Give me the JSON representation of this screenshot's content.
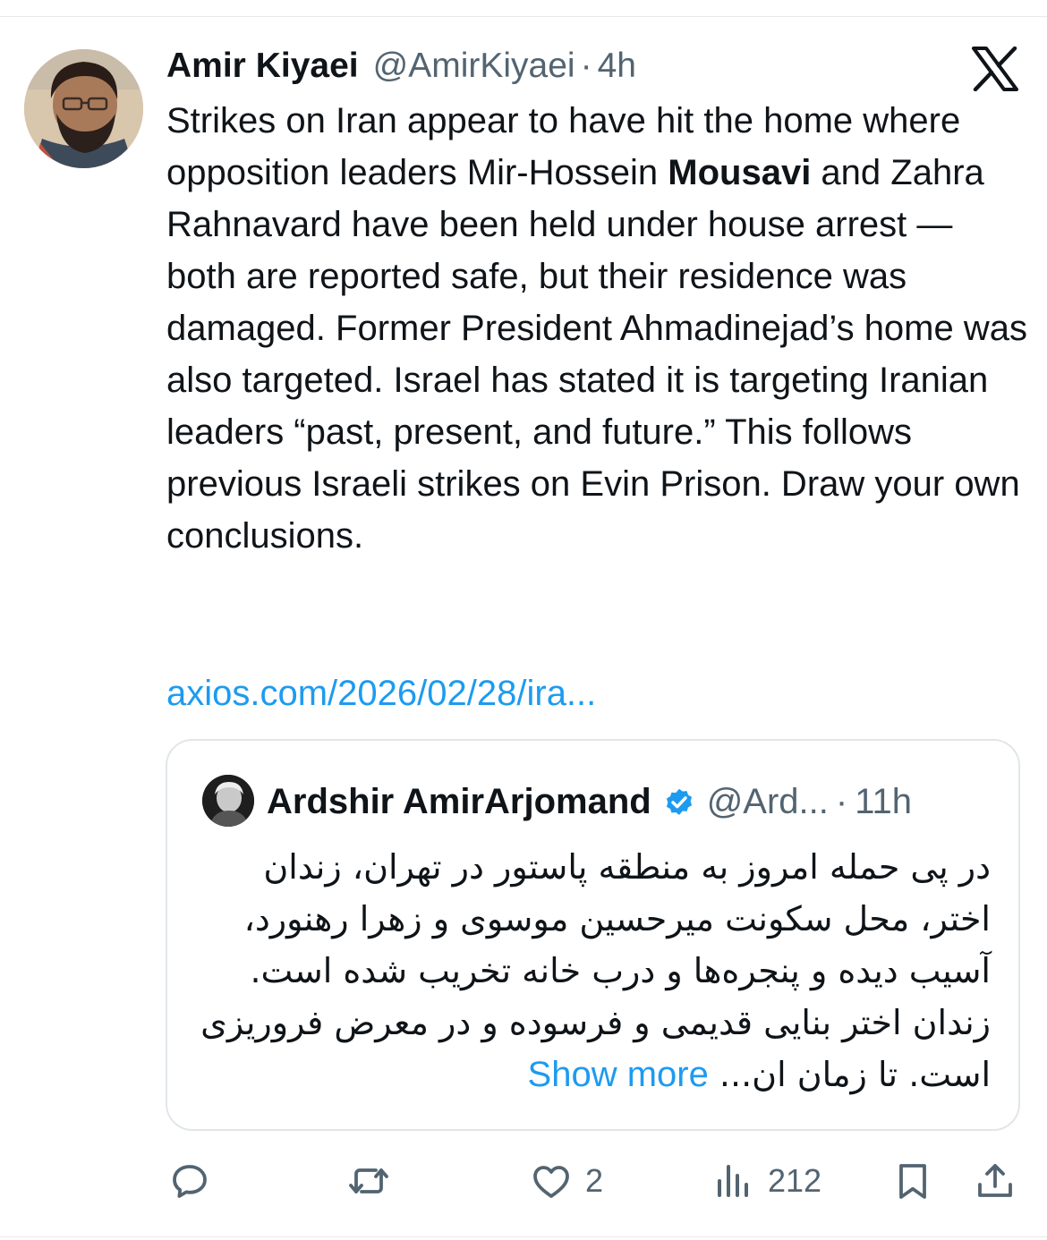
{
  "tweet": {
    "author_name": "Amir Kiyaei",
    "handle": "@AmirKiyaei",
    "separator": "·",
    "time": "4h",
    "text_part1": "Strikes on Iran appear to have hit the home where opposition leaders Mir-Hossein ",
    "text_bold": "Mousavi",
    "text_part2": " and Zahra Rahnavard have been held under house arrest — both are reported safe, but their residence was damaged. Former President Ahmadinejad’s home was also targeted. Israel has stated it is targeting Iranian leaders “past, present, and future.” This follows previous Israeli strikes on Evin Prison. Draw your own conclusions.",
    "link": "axios.com/2026/02/28/ira..."
  },
  "quote": {
    "author_name": "Ardshir AmirArjomand",
    "handle": "@Ard...",
    "separator": "·",
    "time": "11h",
    "text": "در پی حمله امروز به منطقه پاستور در تهران، زندان اختر، محل سکونت میرحسین موسوی و زهرا رهنورد، آسیب دیده و پنجره‌ها و درب خانه تخریب شده است. زندان اختر بنایی قدیمی و فرسوده  و در معرض فروریزی است. تا زمان ان... ",
    "show_more": "Show more"
  },
  "actions": {
    "likes": "2",
    "views": "212"
  },
  "icons": {
    "reply": "reply-icon",
    "repost": "repost-icon",
    "like": "heart-icon",
    "views": "views-icon",
    "bookmark": "bookmark-icon",
    "share": "share-icon",
    "logo": "x-logo-icon",
    "verified": "verified-badge-icon"
  },
  "colors": {
    "text": "#0f1419",
    "secondary": "#536471",
    "link": "#1d9bf0",
    "border": "#e1e6ea"
  }
}
